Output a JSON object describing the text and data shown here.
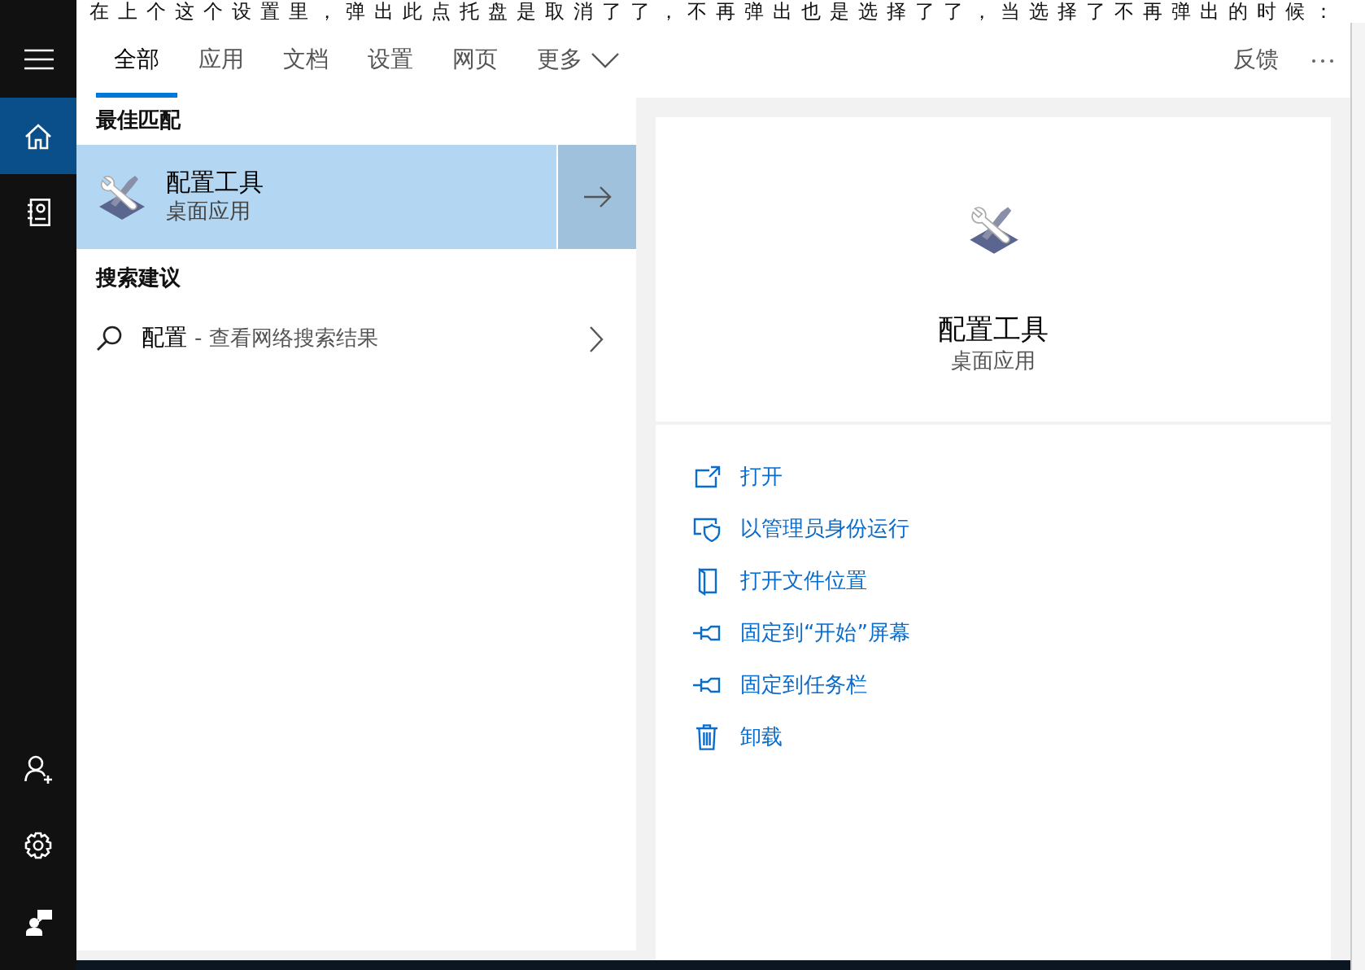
{
  "background_text": "在上个这个设置里，弹出此点托盘是取消了了，不再弹出也是选择了了，当选择了不再弹出的时候：",
  "sidebar": {
    "top": [
      {
        "kind": "menu",
        "selected": false
      },
      {
        "kind": "home",
        "selected": true
      },
      {
        "kind": "notebook",
        "selected": false
      }
    ],
    "bottom": [
      {
        "kind": "person-add"
      },
      {
        "kind": "settings"
      },
      {
        "kind": "feedback"
      }
    ]
  },
  "tabs": [
    {
      "label": "全部",
      "kind": "tab",
      "selected": true
    },
    {
      "label": "应用",
      "kind": "tab",
      "selected": false
    },
    {
      "label": "文档",
      "kind": "tab",
      "selected": false
    },
    {
      "label": "设置",
      "kind": "tab",
      "selected": false
    },
    {
      "label": "网页",
      "kind": "tab",
      "selected": false
    },
    {
      "label": "更多",
      "kind": "dropdown",
      "selected": false
    }
  ],
  "feedback": "反馈",
  "best_match": {
    "heading": "最佳匹配",
    "title": "配置工具",
    "subtitle": "桌面应用",
    "selected": true
  },
  "suggestions": {
    "heading": "搜索建议",
    "items": [
      {
        "query": "配置",
        "hint": "- 查看网络搜索结果"
      }
    ]
  },
  "detail": {
    "title": "配置工具",
    "subtitle": "桌面应用",
    "actions": [
      {
        "kind": "open",
        "label": "打开"
      },
      {
        "kind": "admin",
        "label": "以管理员身份运行"
      },
      {
        "kind": "folder",
        "label": "打开文件位置"
      },
      {
        "kind": "pin",
        "label": "固定到“开始”屏幕"
      },
      {
        "kind": "pin",
        "label": "固定到任务栏"
      },
      {
        "kind": "trash",
        "label": "卸载"
      }
    ]
  }
}
